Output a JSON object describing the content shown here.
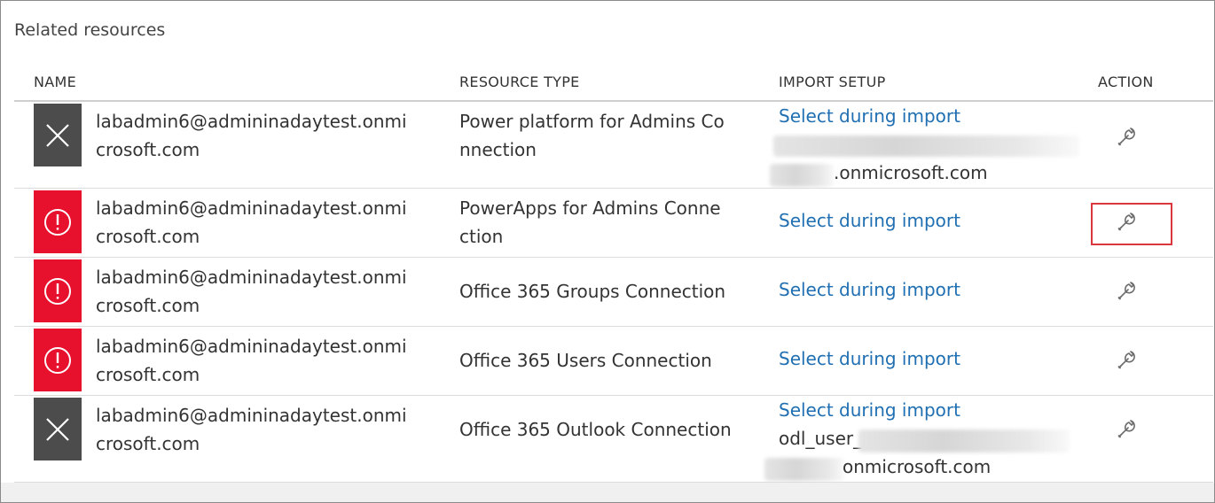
{
  "section": {
    "title": "Related resources"
  },
  "columns": {
    "name": "NAME",
    "type": "RESOURCE TYPE",
    "import": "IMPORT SETUP",
    "action": "ACTION"
  },
  "rows": [
    {
      "name": [
        "labadmin6@admininadaytest.onmi",
        "crosoft.com"
      ],
      "type": [
        "Power platform for Admins Co",
        "nnection"
      ],
      "status": "error-x",
      "import_link": "Select during import",
      "extra_lines": [
        "",
        ".onmicrosoft.com"
      ]
    },
    {
      "name": [
        "labadmin6@admininadaytest.onmi",
        "crosoft.com"
      ],
      "type": [
        "PowerApps for Admins Conne",
        "ction"
      ],
      "status": "warning",
      "import_link": "Select during import"
    },
    {
      "name": [
        "labadmin6@admininadaytest.onmi",
        "crosoft.com"
      ],
      "type": [
        "Office 365 Groups Connection"
      ],
      "status": "warning",
      "import_link": "Select during import"
    },
    {
      "name": [
        "labadmin6@admininadaytest.onmi",
        "crosoft.com"
      ],
      "type": [
        "Office 365 Users Connection"
      ],
      "status": "warning",
      "import_link": "Select during import"
    },
    {
      "name": [
        "labadmin6@admininadaytest.onmi",
        "crosoft.com"
      ],
      "type": [
        "Office 365 Outlook Connection"
      ],
      "status": "error-x",
      "import_link": "Select during import",
      "extra_lines": [
        "odl_user_",
        "onmicrosoft.com"
      ]
    }
  ],
  "icons": {
    "status_error": "close-icon",
    "status_warning": "exclamation-circle-icon",
    "action": "wrench-icon"
  },
  "colors": {
    "status_gray": "#4c4c4c",
    "status_red": "#e8112d",
    "link": "#1f6fb2",
    "highlight": "#d9363e"
  },
  "highlighted_action_row": 1
}
